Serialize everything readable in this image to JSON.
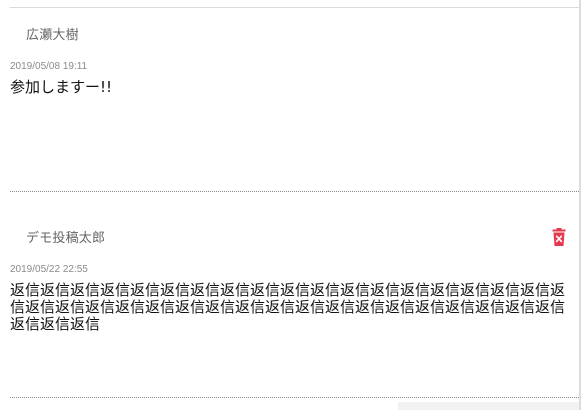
{
  "comments": [
    {
      "author": "広瀬大樹",
      "timestamp": "2019/05/08 19:11",
      "body": "参加しますー!!"
    },
    {
      "author": "デモ投稿太郎",
      "timestamp": "2019/05/22 22:55",
      "body": "返信返信返信返信返信返信返信返信返信返信返信返信返信返信返信返信返信返信返信返信返信返信返信返信返信返信返信返信返信返信返信返信返信返信返信返信返信返信返信返信",
      "delete_icon": "trash-icon"
    }
  ],
  "colors": {
    "delete_icon": "#e53950",
    "divider": "#8a8a8a"
  }
}
